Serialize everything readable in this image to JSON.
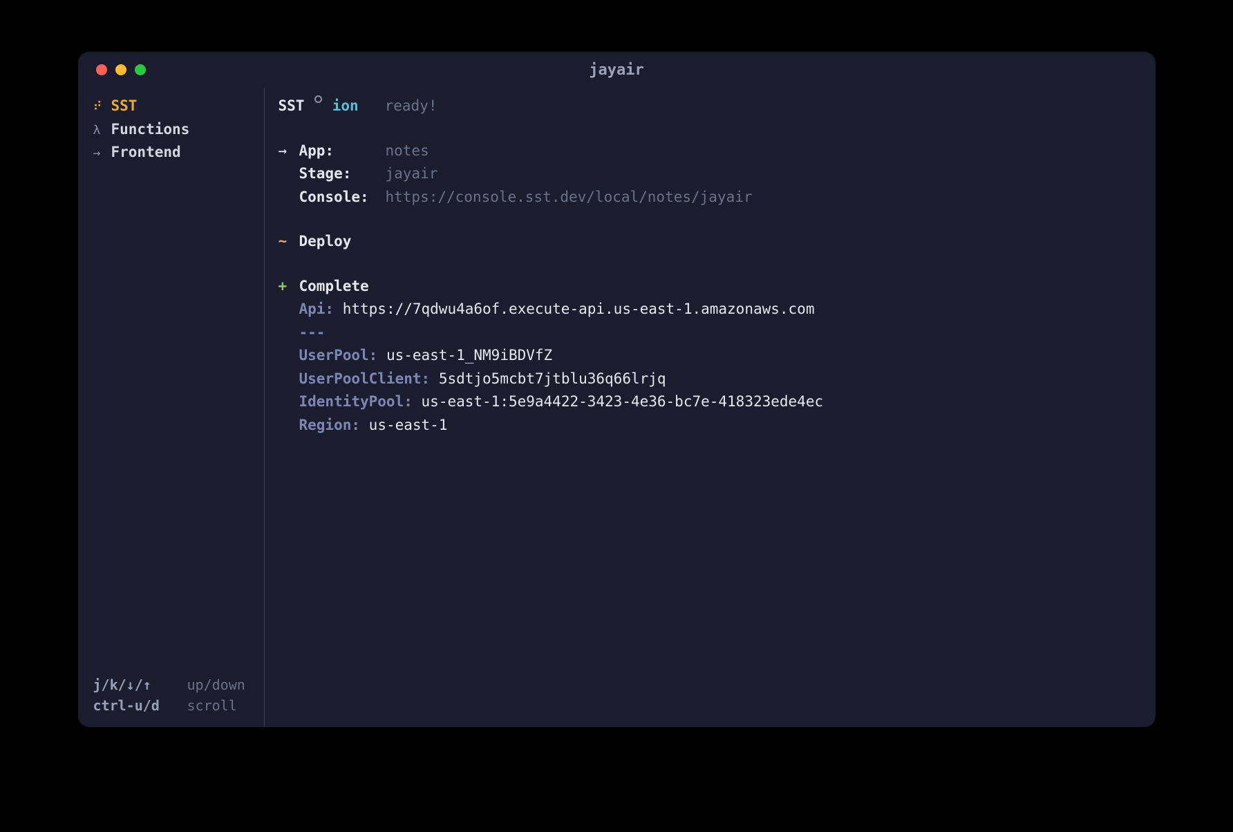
{
  "window": {
    "title": "jayair"
  },
  "sidebar": {
    "items": [
      {
        "icon": "⠞",
        "label": "SST",
        "active": true
      },
      {
        "icon": "λ",
        "label": "Functions",
        "active": false
      },
      {
        "icon": "→",
        "label": "Frontend",
        "active": false
      }
    ],
    "hints": [
      {
        "keys": "j/k/↓/↑",
        "desc": "up/down"
      },
      {
        "keys": "ctrl-u/d",
        "desc": "scroll"
      }
    ]
  },
  "main": {
    "header": {
      "brand": "SST",
      "sub": "ion",
      "status": "ready!"
    },
    "info": {
      "arrow": "→",
      "app_label": "App:",
      "app_value": "notes",
      "stage_label": "Stage:",
      "stage_value": "jayair",
      "console_label": "Console:",
      "console_value": "https://console.sst.dev/local/notes/jayair"
    },
    "deploy": {
      "marker": "~",
      "label": "Deploy"
    },
    "complete": {
      "marker": "+",
      "label": "Complete",
      "outputs": [
        {
          "key": "Api:",
          "value": "https://7qdwu4a6of.execute-api.us-east-1.amazonaws.com"
        }
      ],
      "divider": "---",
      "outputs2": [
        {
          "key": "UserPool:",
          "value": "us-east-1_NM9iBDVfZ"
        },
        {
          "key": "UserPoolClient:",
          "value": "5sdtjo5mcbt7jtblu36q66lrjq"
        },
        {
          "key": "IdentityPool:",
          "value": "us-east-1:5e9a4422-3423-4e36-bc7e-418323ede4ec"
        },
        {
          "key": "Region:",
          "value": "us-east-1"
        }
      ]
    }
  }
}
